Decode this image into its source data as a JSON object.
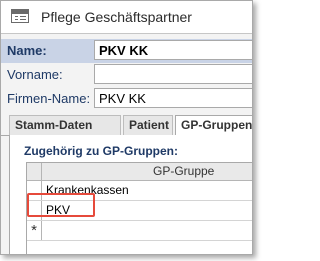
{
  "window": {
    "title": "Pflege Geschäftspartner",
    "icon": "form-icon"
  },
  "fields": [
    {
      "label": "Name:",
      "value": "PKV KK"
    },
    {
      "label": "Vorname:",
      "value": ""
    },
    {
      "label": "Firmen-Name:",
      "value": "PKV KK"
    }
  ],
  "tabs": [
    {
      "label": "Stamm-Daten"
    },
    {
      "label": "Patient"
    },
    {
      "label": "GP-Gruppen / -Syn"
    }
  ],
  "gruppen": {
    "section_label": "Zugehörig zu GP-Gruppen:",
    "column_header": "GP-Gruppe",
    "rows": [
      "Krankenkassen",
      "PKV"
    ],
    "new_row_marker": "*"
  },
  "colors": {
    "highlight": "#e64a3b",
    "name_row_bg": "#c9d3e6",
    "label_text": "#1f3a66"
  }
}
